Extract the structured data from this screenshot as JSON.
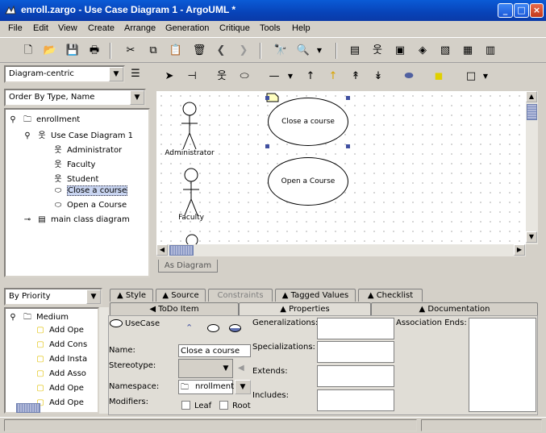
{
  "window": {
    "title": "enroll.zargo - Use Case Diagram 1 - ArgoUML *"
  },
  "menu": [
    "File",
    "Edit",
    "View",
    "Create",
    "Arrange",
    "Generation",
    "Critique",
    "Tools",
    "Help"
  ],
  "explorer": {
    "perspective": "Diagram-centric",
    "order": "Order By Type, Name",
    "tree": [
      {
        "label": "enrollment",
        "icon": "folder-icon"
      },
      {
        "label": "Use Case Diagram 1",
        "icon": "usecase-diagram-icon"
      },
      {
        "label": "Administrator",
        "icon": "actor-icon"
      },
      {
        "label": "Faculty",
        "icon": "actor-icon"
      },
      {
        "label": "Student",
        "icon": "actor-icon"
      },
      {
        "label": "Close a course",
        "icon": "usecase-icon"
      },
      {
        "label": "Open a Course",
        "icon": "usecase-icon"
      },
      {
        "label": "main class diagram",
        "icon": "class-diagram-icon"
      }
    ]
  },
  "diagram": {
    "actors": [
      "Administrator",
      "Faculty"
    ],
    "usecases": [
      "Close a course",
      "Open a Course"
    ],
    "tab": "As Diagram"
  },
  "todo": {
    "priority": "By Priority",
    "group": "Medium",
    "items": [
      "Add Ope",
      "Add Cons",
      "Add Insta",
      "Add Asso",
      "Add Ope",
      "Add Ope"
    ]
  },
  "details": {
    "tabs_top": [
      "Style",
      "Source",
      "Constraints",
      "Tagged Values",
      "Checklist"
    ],
    "tabs_bottom": [
      "ToDo Item",
      "Properties",
      "Documentation"
    ],
    "element_type": "UseCase",
    "name_label": "Name:",
    "name_value": "Close a course",
    "stereotype_label": "Stereotype:",
    "namespace_label": "Namespace:",
    "namespace_value": "nrollment",
    "modifiers_label": "Modifiers:",
    "leaf_label": "Leaf",
    "root_label": "Root",
    "generalizations_label": "Generalizations:",
    "specializations_label": "Specializations:",
    "extends_label": "Extends:",
    "includes_label": "Includes:",
    "association_ends_label": "Association Ends:"
  }
}
